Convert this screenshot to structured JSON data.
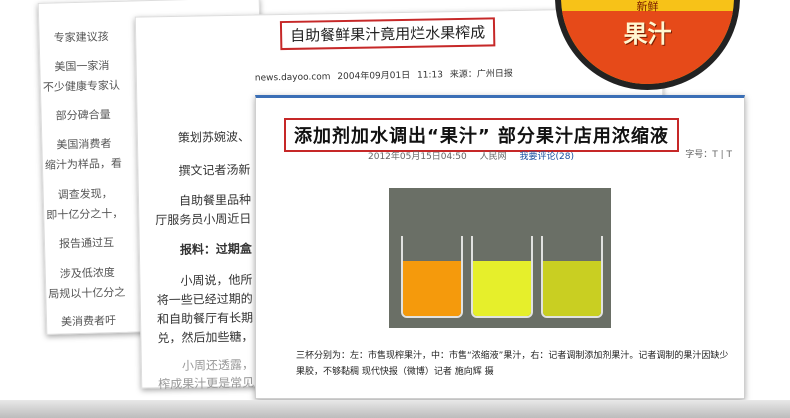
{
  "card1": {
    "lines": [
      "专家建议孩",
      "美国一家消",
      "不少健康专家认",
      "部分碑合量",
      "美国消费者",
      "缩汁为样品，看",
      "调查发现，",
      "即十亿分之十，",
      "报告通过互",
      "涉及低浓度",
      "局规以十亿分之",
      "美消费者吁"
    ]
  },
  "card2": {
    "headline": "自助餐鲜果汁竟用烂水果榨成",
    "meta": "news.dayoo.com      2004年09月01日 11:13      来源：广州日报",
    "lines": [
      "策划苏婉波、",
      "撰文记者汤新",
      "自助餐里品种",
      "厅服务员小周近日",
      "报料：过期盒",
      "小周说，他所",
      "将一些已经过期的",
      "和自助餐厅有长期",
      "兑，然后加些糖，",
      "小周还透露，",
      "榨成果汁更是常见"
    ]
  },
  "card3": {
    "headline": "添加剂加水调出“果汁” 部分果汁店用浓缩液",
    "date": "2012年05月15日04:50",
    "source": "人民网",
    "comment": "我要评论(28)",
    "font_label": "字号：T | T",
    "caption": "三杯分别为：左：市售现榨果汁，中：市售“浓缩液”果汁，右：记者调制添加剂果汁。记者调制的果汁因缺少果胶，不够黏稠 现代快报（微博）记者 施向辉 摄"
  },
  "photo": {
    "liquid_colors": [
      "#f59a0c",
      "#e6ef2b",
      "#c9cf22"
    ]
  },
  "logo": {
    "text": "果汁",
    "small": "新鲜"
  }
}
